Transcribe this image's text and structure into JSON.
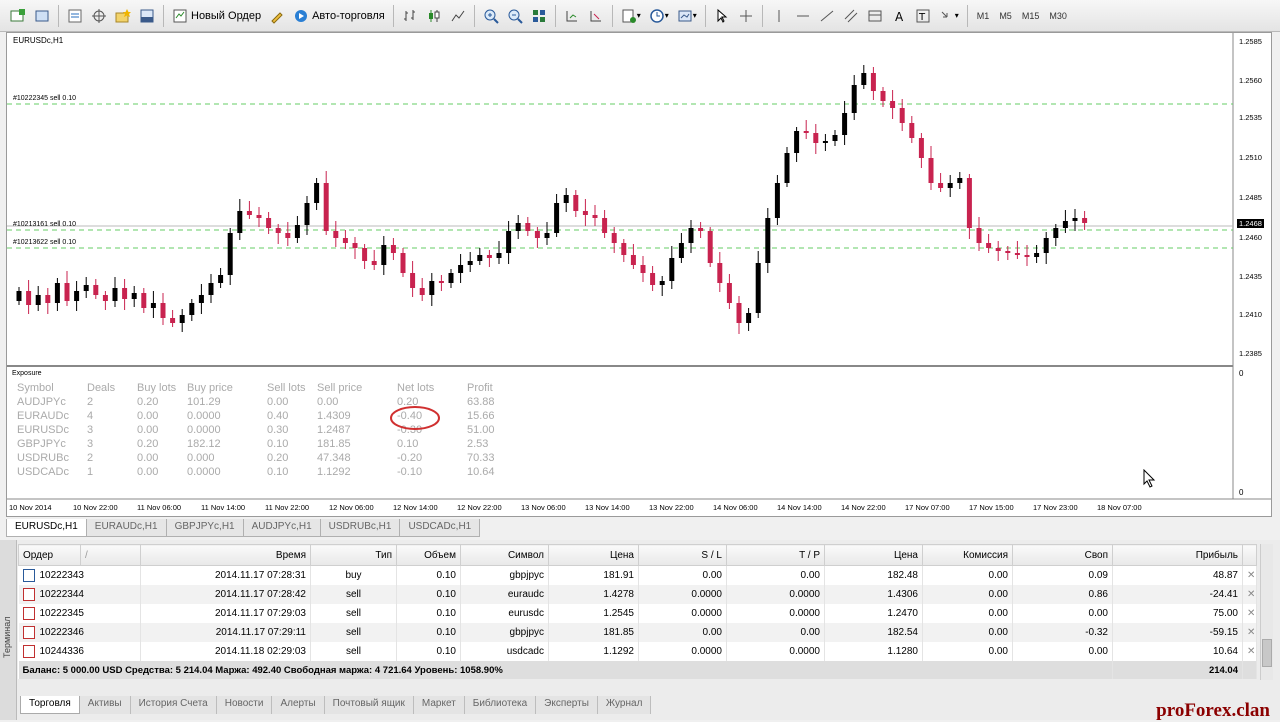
{
  "toolbar": {
    "new_order": "Новый Ордер",
    "auto_trading": "Авто-торговля",
    "timeframes": [
      "M1",
      "M5",
      "M15",
      "M30"
    ]
  },
  "chart": {
    "title": "EURUSDc,H1",
    "price_labels": [
      "1.2585",
      "1.2560",
      "1.2535",
      "1.2510",
      "1.2485",
      "1.2460",
      "1.2435",
      "1.2410",
      "1.2385"
    ],
    "current_price": "1.2468",
    "order_lines": [
      "#10222345 sell 0.10",
      "#10213161 sell 0.10",
      "#10213622 sell 0.10"
    ],
    "subwindow_labels": [
      "0",
      "0"
    ],
    "time_labels": [
      "10 Nov 2014",
      "10 Nov 22:00",
      "11 Nov 06:00",
      "11 Nov 14:00",
      "11 Nov 22:00",
      "12 Nov 06:00",
      "12 Nov 14:00",
      "12 Nov 22:00",
      "13 Nov 06:00",
      "13 Nov 14:00",
      "13 Nov 22:00",
      "14 Nov 06:00",
      "14 Nov 14:00",
      "14 Nov 22:00",
      "17 Nov 07:00",
      "17 Nov 15:00",
      "17 Nov 23:00",
      "18 Nov 07:00"
    ],
    "colors": {
      "bull": "#000000",
      "bear": "#c8234f",
      "sell_line": "#66cc66"
    }
  },
  "exposure": {
    "title": "Exposure",
    "headers": [
      "Symbol",
      "Deals",
      "Buy lots",
      "Buy price",
      "Sell lots",
      "Sell price",
      "Net lots",
      "Profit"
    ],
    "rows": [
      [
        "AUDJPYc",
        "2",
        "0.20",
        "101.29",
        "0.00",
        "0.00",
        "0.20",
        "63.88"
      ],
      [
        "EURAUDc",
        "4",
        "0.00",
        "0.0000",
        "0.40",
        "1.4309",
        "-0.40",
        "15.66"
      ],
      [
        "EURUSDc",
        "3",
        "0.00",
        "0.0000",
        "0.30",
        "1.2487",
        "-0.30",
        "51.00"
      ],
      [
        "GBPJPYc",
        "3",
        "0.20",
        "182.12",
        "0.10",
        "181.85",
        "0.10",
        "2.53"
      ],
      [
        "USDRUBc",
        "2",
        "0.00",
        "0.000",
        "0.20",
        "47.348",
        "-0.20",
        "70.33"
      ],
      [
        "USDCADc",
        "1",
        "0.00",
        "0.0000",
        "0.10",
        "1.1292",
        "-0.10",
        "10.64"
      ]
    ]
  },
  "chart_tabs": [
    "EURUSDc,H1",
    "EURAUDc,H1",
    "GBPJPYc,H1",
    "AUDJPYc,H1",
    "USDRUBc,H1",
    "USDCADc,H1"
  ],
  "terminal": {
    "side_label": "Терминал",
    "headers": [
      "Ордер",
      "/",
      "Время",
      "Тип",
      "Объем",
      "Символ",
      "Цена",
      "S / L",
      "T / P",
      "Цена",
      "Комиссия",
      "Своп",
      "Прибыль"
    ],
    "rows": [
      [
        "10222343",
        "2014.11.17 07:28:31",
        "buy",
        "0.10",
        "gbpjpyc",
        "181.91",
        "0.00",
        "0.00",
        "182.48",
        "0.00",
        "0.09",
        "48.87"
      ],
      [
        "10222344",
        "2014.11.17 07:28:42",
        "sell",
        "0.10",
        "euraudc",
        "1.4278",
        "0.0000",
        "0.0000",
        "1.4306",
        "0.00",
        "0.86",
        "-24.41"
      ],
      [
        "10222345",
        "2014.11.17 07:29:03",
        "sell",
        "0.10",
        "eurusdc",
        "1.2545",
        "0.0000",
        "0.0000",
        "1.2470",
        "0.00",
        "0.00",
        "75.00"
      ],
      [
        "10222346",
        "2014.11.17 07:29:11",
        "sell",
        "0.10",
        "gbpjpyc",
        "181.85",
        "0.00",
        "0.00",
        "182.54",
        "0.00",
        "-0.32",
        "-59.15"
      ],
      [
        "10244336",
        "2014.11.18 02:29:03",
        "sell",
        "0.10",
        "usdcadc",
        "1.1292",
        "0.0000",
        "0.0000",
        "1.1280",
        "0.00",
        "0.00",
        "10.64"
      ]
    ],
    "close_glyph": "✕",
    "balance_text": "Баланс: 5 000.00 USD  Средства: 5 214.04  Маржа: 492.40  Свободная маржа: 4 721.64  Уровень: 1058.90%",
    "balance_total": "214.04",
    "tabs": [
      "Торговля",
      "Активы",
      "История Счета",
      "Новости",
      "Алерты",
      "Почтовый ящик",
      "Маркет",
      "Библиотека",
      "Эксперты",
      "Журнал"
    ]
  },
  "watermark": "proForex.clan"
}
